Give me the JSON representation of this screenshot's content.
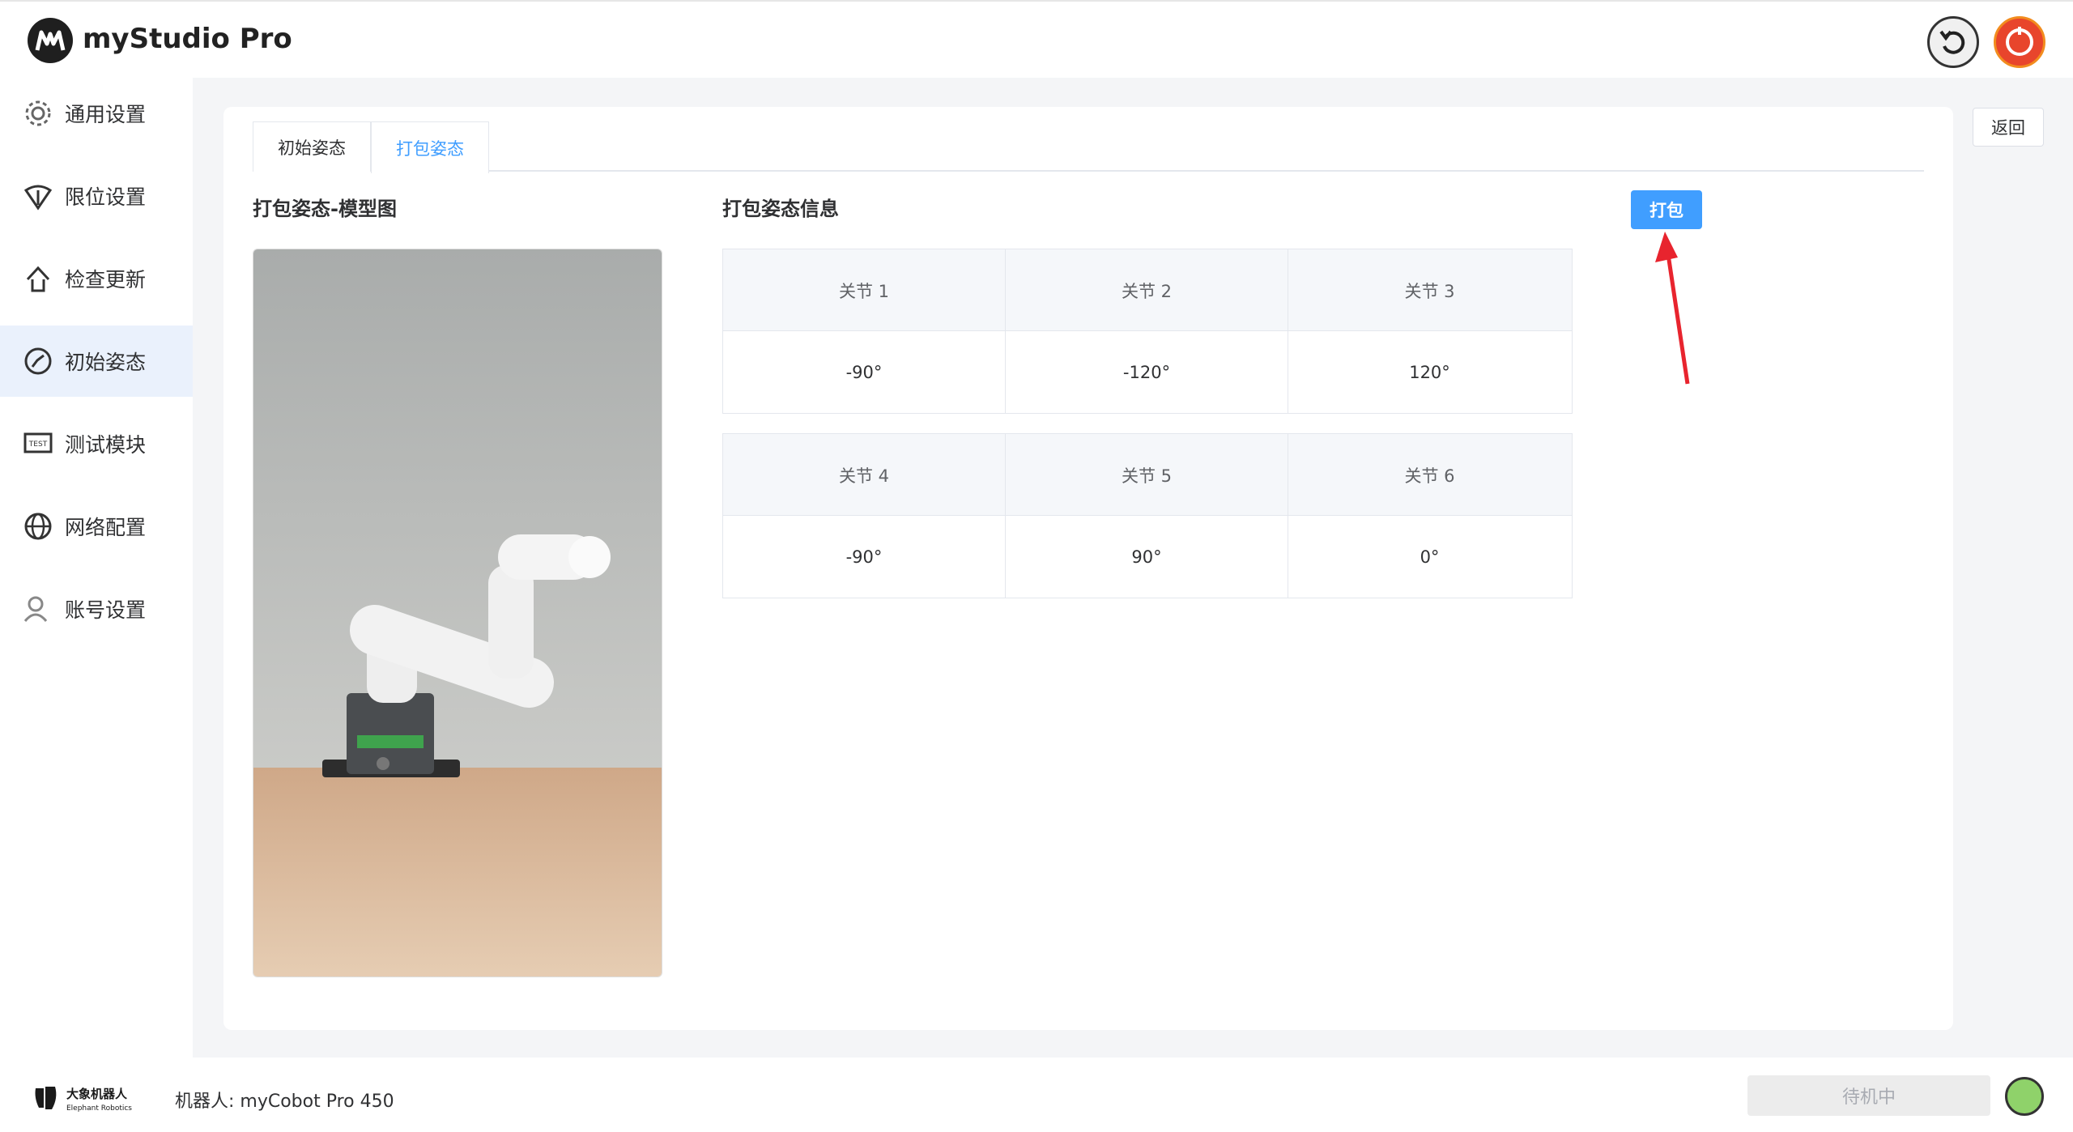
{
  "app": {
    "title": "myStudio Pro"
  },
  "sidebar": {
    "items": [
      {
        "label": "通用设置",
        "icon": "gear-icon"
      },
      {
        "label": "限位设置",
        "icon": "limit-icon"
      },
      {
        "label": "检查更新",
        "icon": "upload-icon"
      },
      {
        "label": "初始姿态",
        "icon": "pose-icon",
        "active": true
      },
      {
        "label": "测试模块",
        "icon": "test-icon"
      },
      {
        "label": "网络配置",
        "icon": "globe-icon"
      },
      {
        "label": "账号设置",
        "icon": "user-icon"
      }
    ]
  },
  "main": {
    "back_label": "返回",
    "tabs": [
      {
        "label": "初始姿态",
        "active": false
      },
      {
        "label": "打包姿态",
        "active": true
      }
    ],
    "model_title": "打包姿态-模型图",
    "info_title": "打包姿态信息",
    "pack_label": "打包",
    "joint_tables": [
      {
        "headers": [
          "关节 1",
          "关节 2",
          "关节 3"
        ],
        "values": [
          "-90°",
          "-120°",
          "120°"
        ]
      },
      {
        "headers": [
          "关节 4",
          "关节 5",
          "关节 6"
        ],
        "values": [
          "-90°",
          "90°",
          "0°"
        ]
      }
    ]
  },
  "footer": {
    "brand_cn": "大象机器人",
    "brand_en": "Elephant Robotics",
    "robot_label": "机器人: myCobot Pro 450",
    "status": "待机中"
  },
  "colors": {
    "accent": "#409eff",
    "status_ok": "#8fd26a",
    "arrow": "#e8242e"
  }
}
